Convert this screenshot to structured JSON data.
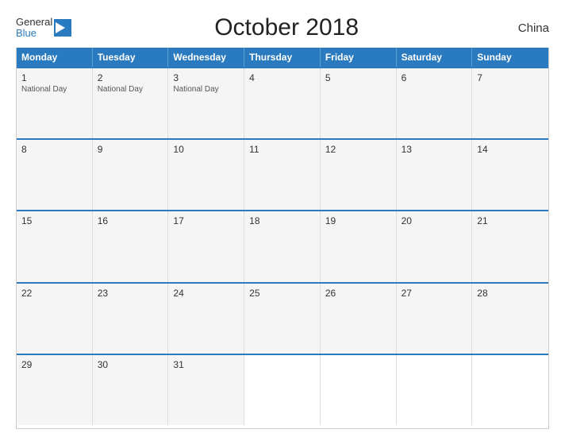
{
  "logo": {
    "general": "General",
    "blue": "Blue"
  },
  "title": "October 2018",
  "country": "China",
  "header": {
    "days": [
      "Monday",
      "Tuesday",
      "Wednesday",
      "Thursday",
      "Friday",
      "Saturday",
      "Sunday"
    ]
  },
  "weeks": [
    [
      {
        "num": "1",
        "event": "National Day"
      },
      {
        "num": "2",
        "event": "National Day"
      },
      {
        "num": "3",
        "event": "National Day"
      },
      {
        "num": "4",
        "event": ""
      },
      {
        "num": "5",
        "event": ""
      },
      {
        "num": "6",
        "event": ""
      },
      {
        "num": "7",
        "event": ""
      }
    ],
    [
      {
        "num": "8",
        "event": ""
      },
      {
        "num": "9",
        "event": ""
      },
      {
        "num": "10",
        "event": ""
      },
      {
        "num": "11",
        "event": ""
      },
      {
        "num": "12",
        "event": ""
      },
      {
        "num": "13",
        "event": ""
      },
      {
        "num": "14",
        "event": ""
      }
    ],
    [
      {
        "num": "15",
        "event": ""
      },
      {
        "num": "16",
        "event": ""
      },
      {
        "num": "17",
        "event": ""
      },
      {
        "num": "18",
        "event": ""
      },
      {
        "num": "19",
        "event": ""
      },
      {
        "num": "20",
        "event": ""
      },
      {
        "num": "21",
        "event": ""
      }
    ],
    [
      {
        "num": "22",
        "event": ""
      },
      {
        "num": "23",
        "event": ""
      },
      {
        "num": "24",
        "event": ""
      },
      {
        "num": "25",
        "event": ""
      },
      {
        "num": "26",
        "event": ""
      },
      {
        "num": "27",
        "event": ""
      },
      {
        "num": "28",
        "event": ""
      }
    ],
    [
      {
        "num": "29",
        "event": ""
      },
      {
        "num": "30",
        "event": ""
      },
      {
        "num": "31",
        "event": ""
      },
      {
        "num": "",
        "event": ""
      },
      {
        "num": "",
        "event": ""
      },
      {
        "num": "",
        "event": ""
      },
      {
        "num": "",
        "event": ""
      }
    ]
  ]
}
